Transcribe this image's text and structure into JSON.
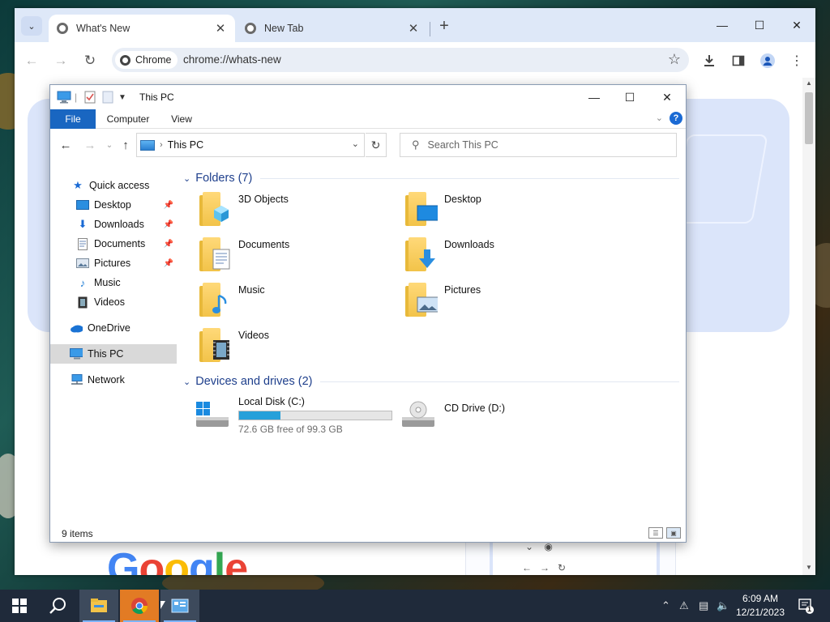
{
  "browser": {
    "tabs": [
      {
        "title": "What's New",
        "active": true
      },
      {
        "title": "New Tab",
        "active": false
      }
    ],
    "chip_label": "Chrome",
    "url": "chrome://whats-new",
    "page": {
      "logo_text": "Google"
    }
  },
  "explorer": {
    "title": "This PC",
    "ribbon_tabs": [
      "File",
      "Computer",
      "View"
    ],
    "address_path": "This PC",
    "search_placeholder": "Search This PC",
    "nav": {
      "quick_access": "Quick access",
      "quick_items": [
        {
          "label": "Desktop",
          "icon": "desktop-icon",
          "pinned": true
        },
        {
          "label": "Downloads",
          "icon": "downloads-icon",
          "pinned": true
        },
        {
          "label": "Documents",
          "icon": "documents-icon",
          "pinned": true
        },
        {
          "label": "Pictures",
          "icon": "pictures-icon",
          "pinned": true
        },
        {
          "label": "Music",
          "icon": "music-icon",
          "pinned": false
        },
        {
          "label": "Videos",
          "icon": "videos-icon",
          "pinned": false
        }
      ],
      "onedrive": "OneDrive",
      "this_pc": "This PC",
      "network": "Network"
    },
    "folders_header": "Folders (7)",
    "folders": [
      {
        "label": "3D Objects",
        "icon": "3d-objects-icon"
      },
      {
        "label": "Desktop",
        "icon": "desktop-folder-icon"
      },
      {
        "label": "Documents",
        "icon": "documents-folder-icon"
      },
      {
        "label": "Downloads",
        "icon": "downloads-folder-icon"
      },
      {
        "label": "Music",
        "icon": "music-folder-icon"
      },
      {
        "label": "Pictures",
        "icon": "pictures-folder-icon"
      },
      {
        "label": "Videos",
        "icon": "videos-folder-icon"
      }
    ],
    "drives_header": "Devices and drives (2)",
    "drives": [
      {
        "label": "Local Disk (C:)",
        "free_text": "72.6 GB free of 99.3 GB",
        "used_fraction": 0.269
      },
      {
        "label": "CD Drive (D:)"
      }
    ],
    "status_count": "9 items"
  },
  "taskbar": {
    "time": "6:09 AM",
    "date": "12/21/2023",
    "notification_count": "1"
  },
  "colors": {
    "file_tab": "#1966c1",
    "group_header": "#1e3f8c",
    "drive_bar": "#26a0da",
    "taskbar": "#1f2a3a"
  }
}
